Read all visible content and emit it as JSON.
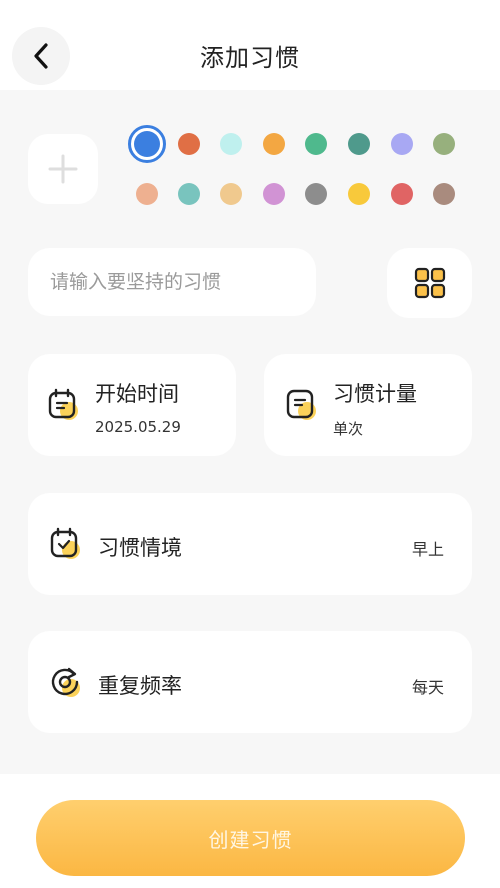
{
  "header": {
    "title": "添加习惯"
  },
  "colors": {
    "accent": "#fbb743",
    "selected_ring": "#3b7fe0",
    "row1": [
      "#3b7fe0",
      "#e06f45",
      "#bff0ee",
      "#f3a742",
      "#4fb98d",
      "#4f9a8c",
      "#a8a8f3",
      "#97b07d"
    ],
    "row2": [
      "#eeb090",
      "#79c4be",
      "#f0c98e",
      "#d193d4",
      "#8d8d8d",
      "#f8c93b",
      "#e06464",
      "#a98b7e"
    ]
  },
  "habit_name": {
    "value": "",
    "placeholder": "请输入要坚持的习惯"
  },
  "start_time": {
    "title": "开始时间",
    "value": "2025.05.29"
  },
  "habit_measure": {
    "title": "习惯计量",
    "value": "单次"
  },
  "habit_context": {
    "title": "习惯情境",
    "value": "早上"
  },
  "repeat_frequency": {
    "title": "重复频率",
    "value": "每天"
  },
  "footer": {
    "create_label": "创建习惯"
  }
}
